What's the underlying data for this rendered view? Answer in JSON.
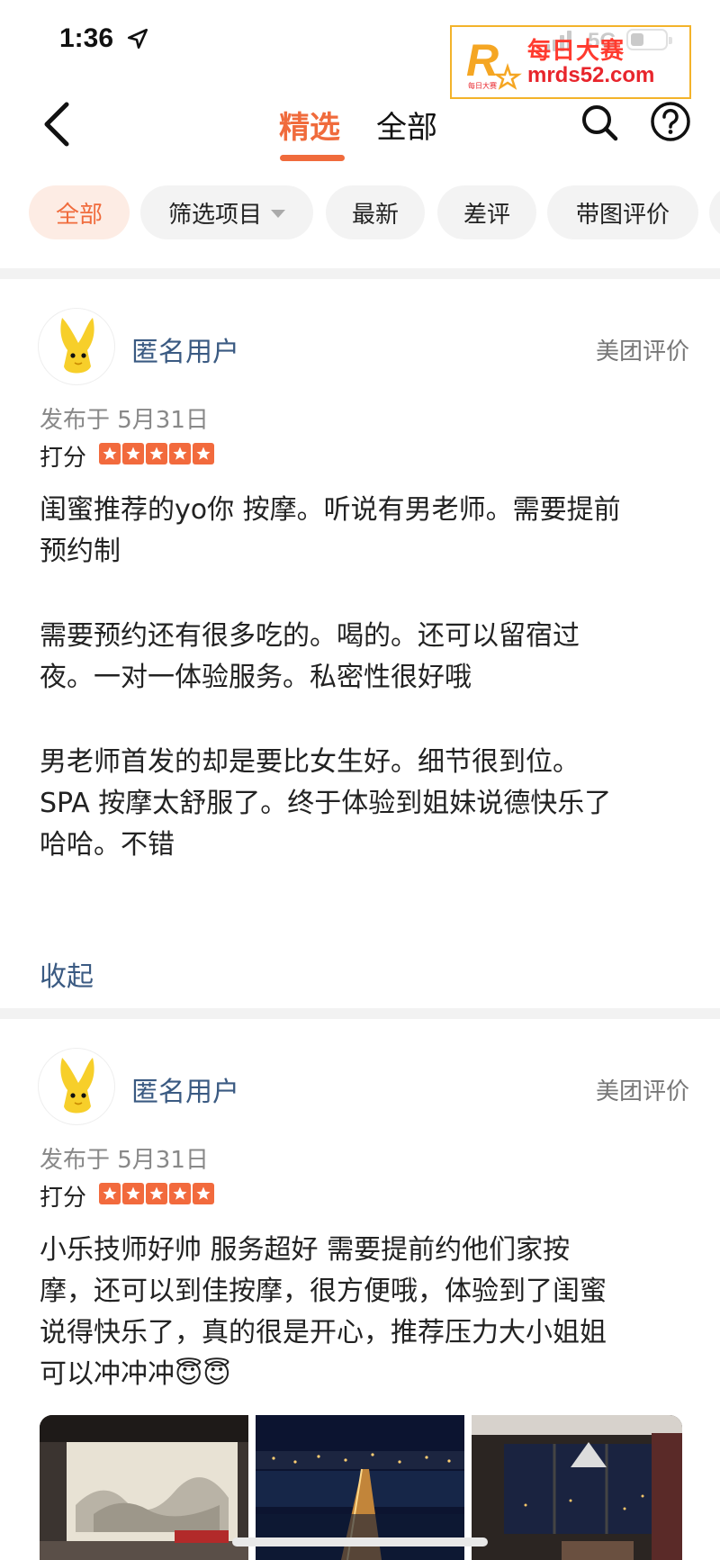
{
  "status_bar": {
    "time": "1:36",
    "network": "5G",
    "icons": [
      "location-arrow-icon",
      "signal-icon",
      "battery-icon"
    ]
  },
  "watermark": {
    "line1": "每日大赛",
    "line2": "mrds52.com",
    "logo_letter": "R",
    "logo_small_text": "每日大赛"
  },
  "nav": {
    "tabs": [
      {
        "label": "精选",
        "selected": true
      },
      {
        "label": "全部",
        "selected": false
      }
    ],
    "icons": [
      "back-chevron-icon",
      "search-icon",
      "help-icon"
    ]
  },
  "filters": [
    {
      "label": "全部",
      "active": true
    },
    {
      "label": "筛选项目",
      "dropdown": true
    },
    {
      "label": "最新"
    },
    {
      "label": "差评"
    },
    {
      "label": "带图评价"
    }
  ],
  "reviews": [
    {
      "user": "匿名用户",
      "source": "美团评价",
      "date": "发布于 5月31日",
      "score_label": "打分",
      "stars": 5,
      "paragraphs": [
        [
          "闺蜜推荐的yo你 按摩。听说有男老师。需要提前",
          "预约制"
        ],
        [
          "需要预约还有很多吃的。喝的。还可以留宿过",
          "夜。一对一体验服务。私密性很好哦"
        ],
        [
          "男老师首发的却是要比女生好。细节很到位。",
          "SPA 按摩太舒服了。终于体验到姐妹说德快乐了",
          "哈哈。不错"
        ]
      ],
      "collapse_label": "收起"
    },
    {
      "user": "匿名用户",
      "source": "美团评价",
      "date": "发布于 5月31日",
      "score_label": "打分",
      "stars": 5,
      "paragraphs": [
        [
          "小乐技师好帅  服务超好  需要提前约他们家按",
          "摩，还可以到佳按摩，很方便哦，体验到了闺蜜",
          "说得快乐了，真的很是开心，推荐压力大小姐姐",
          "可以冲冲冲😇😇"
        ]
      ],
      "photos": [
        "hotel-room-photo",
        "city-night-bridge-photo",
        "window-view-room-photo"
      ]
    }
  ],
  "colors": {
    "accent": "#f06b3c",
    "username": "#3a5a82",
    "chip_bg": "#f3f3f3",
    "chip_active_bg": "#fdece4"
  }
}
